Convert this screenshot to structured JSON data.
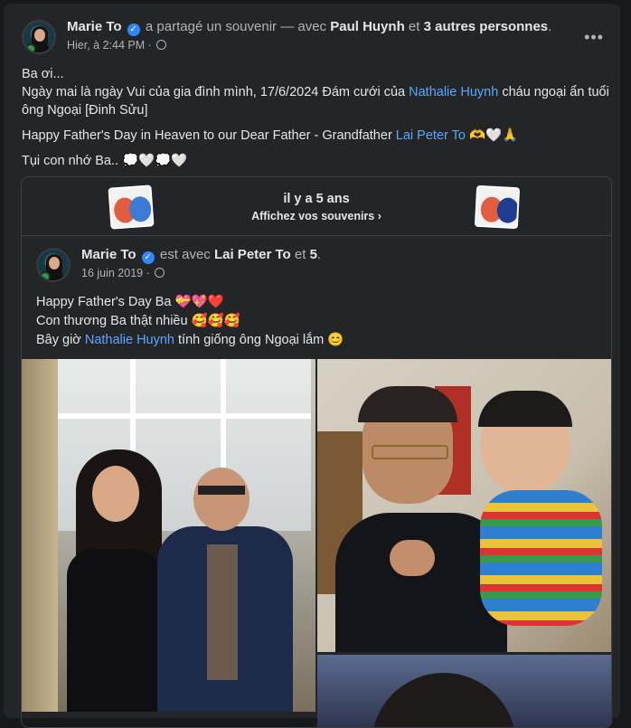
{
  "post": {
    "author": "Marie To",
    "action": "a partagé un souvenir — avec",
    "tagged_first": "Paul Huynh",
    "and": "et",
    "tagged_others": "3 autres personnes",
    "time": "Hier, à 2:44 PM",
    "more_icon": "more-options-icon",
    "text_line1": "Ba ơi...",
    "text_line2_a": "Ngày mai là ngày Vui của gia đình mình, 17/6/2024 Đám cưới của ",
    "text_line2_link": "Nathalie Huynh",
    "text_line2_b": " cháu ngoại ẩn tuổi ông Ngoại [Đinh Sửu]",
    "text_line3_a": "Happy Father's Day in Heaven to our Dear Father - Grandfather ",
    "text_line3_link": "Lai Peter To",
    "text_line3_emoji": " 🫶🤍🙏",
    "text_line4": "Tụi con nhớ Ba.. 💭🤍💭🤍"
  },
  "memory": {
    "title": "il y a 5 ans",
    "subtitle": "Affichez vos souvenirs",
    "chevron_icon": "chevron-right-icon"
  },
  "original": {
    "author": "Marie To",
    "action": "est avec",
    "tagged": "Lai Peter To",
    "and": "et",
    "count": "5",
    "time": "16 juin 2019",
    "line1": "Happy Father's Day Ba 💝💖❤️",
    "line2": "Con thương Ba thật nhiều  🥰🥰🥰",
    "line3_a": "Bây giờ ",
    "line3_link": "Nathalie Huynh",
    "line3_b": " tính giống ông Ngoại lắm 😊"
  },
  "colors": {
    "link": "#5aa7ff",
    "verified": "#2d88ff",
    "card": "#242526"
  }
}
